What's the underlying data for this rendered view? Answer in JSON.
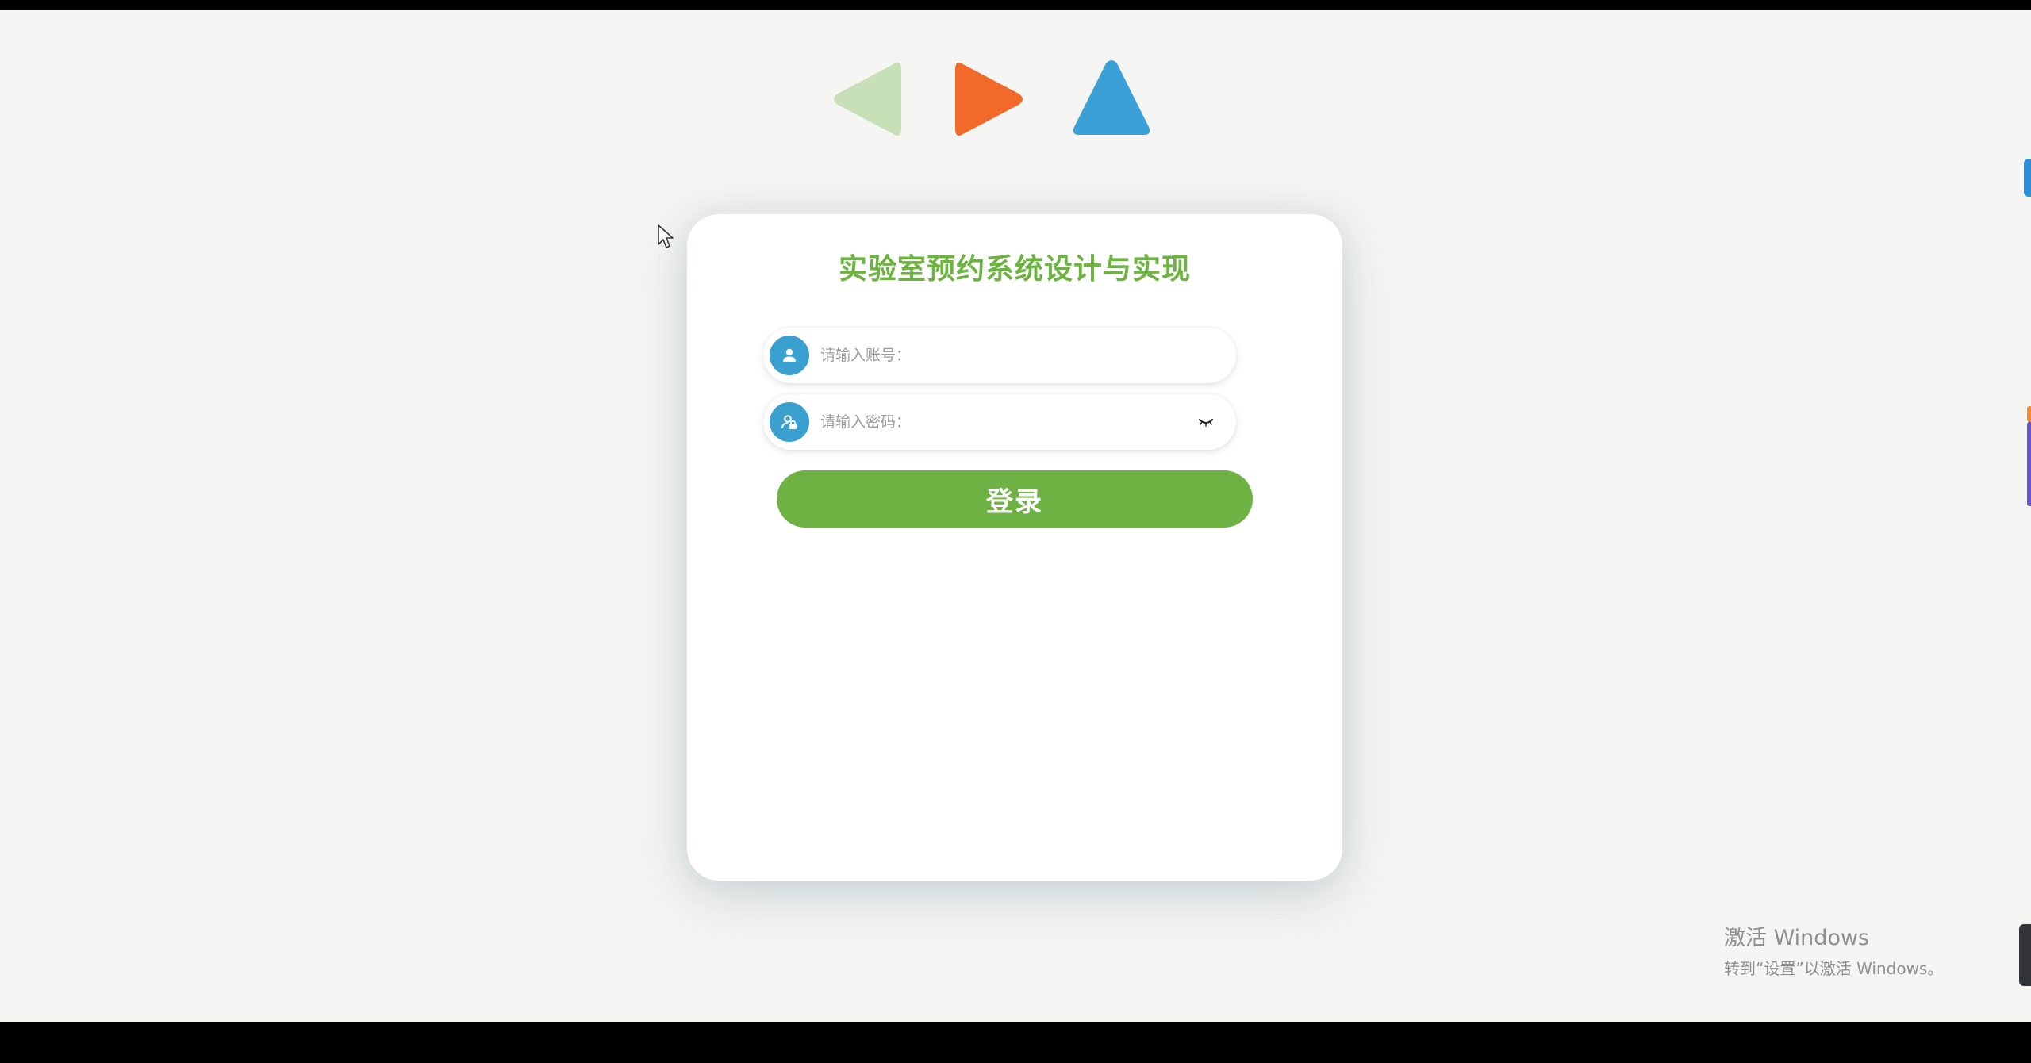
{
  "page": {
    "title": "实验室预约系统设计与实现"
  },
  "logo": {
    "icons": [
      "triangle-left-icon",
      "triangle-right-icon",
      "triangle-up-icon"
    ],
    "colors": [
      "#c8e0b8",
      "#f26a2a",
      "#3aa0d5"
    ]
  },
  "login": {
    "account_placeholder": "请输入账号：",
    "account_value": "",
    "password_placeholder": "请输入密码：",
    "password_value": "",
    "submit_label": "登录"
  },
  "watermark": {
    "title": "激活 Windows",
    "subtitle": "转到“设置”以激活 Windows。"
  },
  "theme": {
    "accent_green": "#6db243",
    "icon_blue": "#3aa0cf",
    "background": "#f5f5f3"
  }
}
